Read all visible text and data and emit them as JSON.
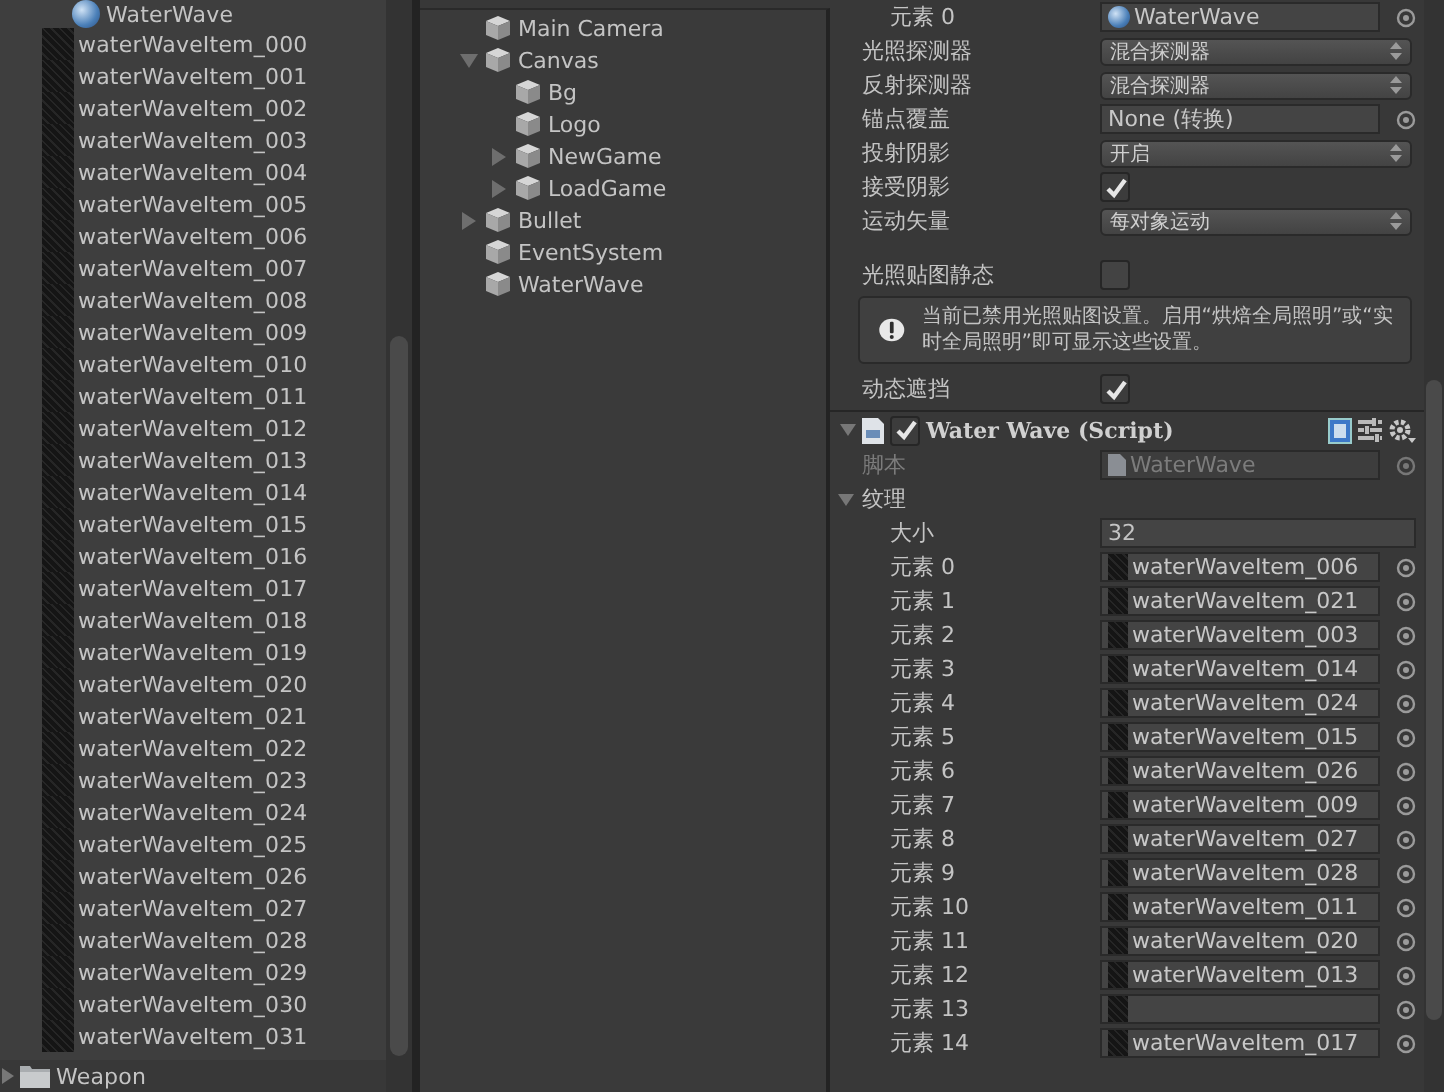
{
  "project_panel": {
    "parent": {
      "label": "WaterWave"
    },
    "items": [
      "waterWaveItem_000",
      "waterWaveItem_001",
      "waterWaveItem_002",
      "waterWaveItem_003",
      "waterWaveItem_004",
      "waterWaveItem_005",
      "waterWaveItem_006",
      "waterWaveItem_007",
      "waterWaveItem_008",
      "waterWaveItem_009",
      "waterWaveItem_010",
      "waterWaveItem_011",
      "waterWaveItem_012",
      "waterWaveItem_013",
      "waterWaveItem_014",
      "waterWaveItem_015",
      "waterWaveItem_016",
      "waterWaveItem_017",
      "waterWaveItem_018",
      "waterWaveItem_019",
      "waterWaveItem_020",
      "waterWaveItem_021",
      "waterWaveItem_022",
      "waterWaveItem_023",
      "waterWaveItem_024",
      "waterWaveItem_025",
      "waterWaveItem_026",
      "waterWaveItem_027",
      "waterWaveItem_028",
      "waterWaveItem_029",
      "waterWaveItem_030",
      "waterWaveItem_031"
    ],
    "folders": [
      {
        "label": "Weapon",
        "expanded": false
      }
    ]
  },
  "hierarchy": {
    "items": [
      {
        "label": "Main Camera"
      },
      {
        "label": "Canvas",
        "expanded": true,
        "children": [
          {
            "label": "Bg"
          },
          {
            "label": "Logo"
          },
          {
            "label": "NewGame",
            "expanded": false
          },
          {
            "label": "LoadGame",
            "expanded": false
          }
        ]
      },
      {
        "label": "Bullet",
        "expanded": false
      },
      {
        "label": "EventSystem"
      },
      {
        "label": "WaterWave"
      }
    ]
  },
  "inspector": {
    "rows": [
      {
        "kind": "element",
        "label": "元素 0",
        "value": "WaterWave"
      },
      {
        "kind": "dropdown",
        "label": "光照探测器",
        "value": "混合探测器"
      },
      {
        "kind": "dropdown",
        "label": "反射探测器",
        "value": "混合探测器"
      },
      {
        "kind": "object",
        "label": "锚点覆盖",
        "value": "None (转换)"
      },
      {
        "kind": "dropdown",
        "label": "投射阴影",
        "value": "开启"
      },
      {
        "kind": "checkbox",
        "label": "接受阴影",
        "checked": true
      },
      {
        "kind": "dropdown",
        "label": "运动矢量",
        "value": "每对象运动"
      },
      {
        "kind": "gap"
      },
      {
        "kind": "checkbox",
        "label": "光照贴图静态",
        "checked": false
      },
      {
        "kind": "notice",
        "text": "当前已禁用光照贴图设置。启用“烘焙全局照明”或“实时全局照明”即可显示这些设置。"
      },
      {
        "kind": "checkbox",
        "label": "动态遮挡",
        "checked": true
      }
    ],
    "component": {
      "title": "Water Wave (Script)",
      "enabled": true,
      "expanded": true,
      "script_label": "脚本",
      "script_value": "WaterWave",
      "textures": {
        "label": "纹理",
        "expanded": true,
        "size_label": "大小",
        "size": "32",
        "elements": [
          {
            "label": "元素 0",
            "value": "waterWaveItem_006"
          },
          {
            "label": "元素 1",
            "value": "waterWaveItem_021"
          },
          {
            "label": "元素 2",
            "value": "waterWaveItem_003"
          },
          {
            "label": "元素 3",
            "value": "waterWaveItem_014"
          },
          {
            "label": "元素 4",
            "value": "waterWaveItem_024"
          },
          {
            "label": "元素 5",
            "value": "waterWaveItem_015"
          },
          {
            "label": "元素 6",
            "value": "waterWaveItem_026"
          },
          {
            "label": "元素 7",
            "value": "waterWaveItem_009"
          },
          {
            "label": "元素 8",
            "value": "waterWaveItem_027"
          },
          {
            "label": "元素 9",
            "value": "waterWaveItem_028"
          },
          {
            "label": "元素 10",
            "value": "waterWaveItem_011"
          },
          {
            "label": "元素 11",
            "value": "waterWaveItem_020"
          },
          {
            "label": "元素 12",
            "value": "waterWaveItem_013"
          },
          {
            "label": "元素 13"
          },
          {
            "label": "元素 14",
            "value": "waterWaveItem_017"
          }
        ]
      }
    }
  }
}
